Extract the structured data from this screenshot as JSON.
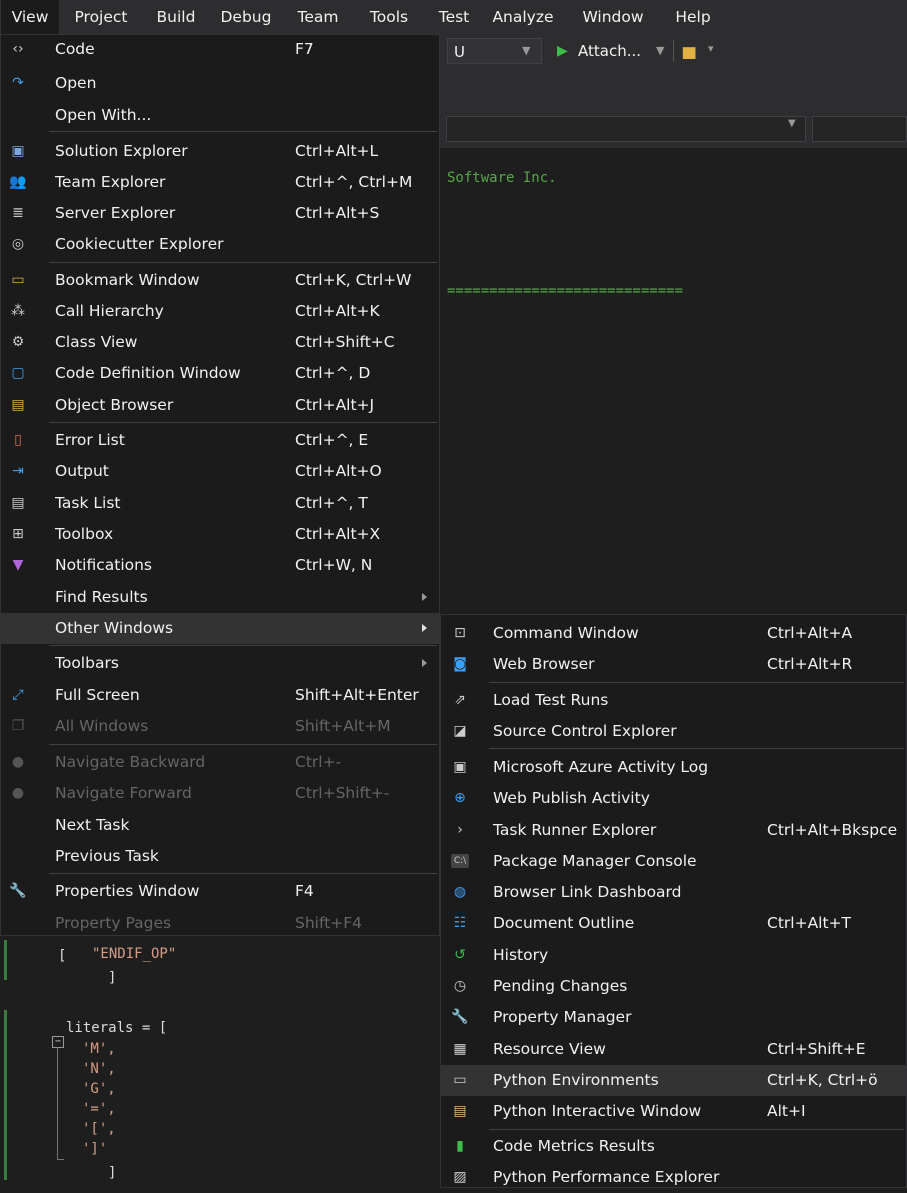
{
  "menubar": [
    "View",
    "Project",
    "Build",
    "Debug",
    "Team",
    "Tools",
    "Test",
    "Analyze",
    "Window",
    "Help"
  ],
  "toolbar": {
    "config_value": "U",
    "attach_label": "Attach..."
  },
  "editor": {
    "line_company": "Software Inc.",
    "line_rule": "============================",
    "code_lines": [
      {
        "text": "[",
        "cls": "plain"
      },
      {
        "text": "\"ENDIF_OP\"",
        "cls": "orange"
      },
      {
        "text": "]",
        "cls": "plain"
      },
      {
        "text": "literals = [",
        "cls": "plain"
      },
      {
        "text": "'M',",
        "cls": "orange"
      },
      {
        "text": "'N',",
        "cls": "orange"
      },
      {
        "text": "'G',",
        "cls": "orange"
      },
      {
        "text": "'=',",
        "cls": "orange"
      },
      {
        "text": "'[',",
        "cls": "orange"
      },
      {
        "text": "']'",
        "cls": "orange"
      },
      {
        "text": "]",
        "cls": "plain"
      }
    ]
  },
  "view_menu": [
    {
      "label": "Code",
      "shortcut": "F7",
      "icon": "code-icon",
      "glyph": "‹›",
      "color": "#cccccc"
    },
    {
      "label": "Open",
      "shortcut": "",
      "icon": "open-icon",
      "glyph": "↷",
      "color": "#3ea0f0"
    },
    {
      "label": "Open With...",
      "shortcut": "",
      "icon": "",
      "glyph": "",
      "color": ""
    },
    {
      "label": "Solution Explorer",
      "shortcut": "Ctrl+Alt+L",
      "icon": "solution-explorer-icon",
      "glyph": "▣",
      "color": "#7aa6d8"
    },
    {
      "label": "Team Explorer",
      "shortcut": "Ctrl+^, Ctrl+M",
      "icon": "team-explorer-icon",
      "glyph": "👥",
      "color": "#cccccc"
    },
    {
      "label": "Server Explorer",
      "shortcut": "Ctrl+Alt+S",
      "icon": "server-explorer-icon",
      "glyph": "≣",
      "color": "#cccccc"
    },
    {
      "label": "Cookiecutter Explorer",
      "shortcut": "",
      "icon": "cookiecutter-icon",
      "glyph": "◎",
      "color": "#cccccc"
    },
    {
      "label": "Bookmark Window",
      "shortcut": "Ctrl+K, Ctrl+W",
      "icon": "bookmark-icon",
      "glyph": "▭",
      "color": "#e0b040"
    },
    {
      "label": "Call Hierarchy",
      "shortcut": "Ctrl+Alt+K",
      "icon": "call-hierarchy-icon",
      "glyph": "⁂",
      "color": "#cccccc"
    },
    {
      "label": "Class View",
      "shortcut": "Ctrl+Shift+C",
      "icon": "class-view-icon",
      "glyph": "⚙",
      "color": "#cccccc"
    },
    {
      "label": "Code Definition Window",
      "shortcut": "Ctrl+^, D",
      "icon": "code-definition-icon",
      "glyph": "▢",
      "color": "#3ea0f0"
    },
    {
      "label": "Object Browser",
      "shortcut": "Ctrl+Alt+J",
      "icon": "object-browser-icon",
      "glyph": "▤",
      "color": "#e0b040"
    },
    {
      "label": "Error List",
      "shortcut": "Ctrl+^, E",
      "icon": "error-list-icon",
      "glyph": "▯",
      "color": "#e06c4a"
    },
    {
      "label": "Output",
      "shortcut": "Ctrl+Alt+O",
      "icon": "output-icon",
      "glyph": "⇥",
      "color": "#3ea0f0"
    },
    {
      "label": "Task List",
      "shortcut": "Ctrl+^, T",
      "icon": "task-list-icon",
      "glyph": "▤",
      "color": "#cccccc"
    },
    {
      "label": "Toolbox",
      "shortcut": "Ctrl+Alt+X",
      "icon": "toolbox-icon",
      "glyph": "⊞",
      "color": "#cccccc"
    },
    {
      "label": "Notifications",
      "shortcut": "Ctrl+W, N",
      "icon": "notifications-icon",
      "glyph": "▼",
      "color": "#b066d8"
    },
    {
      "label": "Find Results",
      "shortcut": "",
      "icon": "",
      "glyph": "",
      "color": "",
      "submenu": true
    },
    {
      "label": "Other Windows",
      "shortcut": "",
      "icon": "",
      "glyph": "",
      "color": "",
      "submenu": true,
      "highlighted": true
    },
    {
      "label": "Toolbars",
      "shortcut": "",
      "icon": "",
      "glyph": "",
      "color": "",
      "submenu": true
    },
    {
      "label": "Full Screen",
      "shortcut": "Shift+Alt+Enter",
      "icon": "full-screen-icon",
      "glyph": "⤢",
      "color": "#3ea0f0"
    },
    {
      "label": "All Windows",
      "shortcut": "Shift+Alt+M",
      "icon": "all-windows-icon",
      "glyph": "❐",
      "color": "#555555",
      "disabled": true
    },
    {
      "label": "Navigate Backward",
      "shortcut": "Ctrl+-",
      "icon": "navigate-backward-icon",
      "glyph": "●",
      "color": "#555555",
      "disabled": true
    },
    {
      "label": "Navigate Forward",
      "shortcut": "Ctrl+Shift+-",
      "icon": "navigate-forward-icon",
      "glyph": "●",
      "color": "#555555",
      "disabled": true
    },
    {
      "label": "Next Task",
      "shortcut": "",
      "icon": "",
      "glyph": "",
      "color": ""
    },
    {
      "label": "Previous Task",
      "shortcut": "",
      "icon": "",
      "glyph": "",
      "color": ""
    },
    {
      "label": "Properties Window",
      "shortcut": "F4",
      "icon": "properties-wrench-icon",
      "glyph": "🔧",
      "color": "#cccccc"
    },
    {
      "label": "Property Pages",
      "shortcut": "Shift+F4",
      "icon": "",
      "glyph": "",
      "color": "",
      "disabled": true
    }
  ],
  "other_windows_menu": [
    {
      "label": "Command Window",
      "shortcut": "Ctrl+Alt+A",
      "icon": "command-window-icon",
      "glyph": "⊡",
      "color": "#cccccc"
    },
    {
      "label": "Web Browser",
      "shortcut": "Ctrl+Alt+R",
      "icon": "web-browser-icon",
      "glyph": "◙",
      "color": "#3ea0f0"
    },
    {
      "label": "Load Test Runs",
      "shortcut": "",
      "icon": "load-test-icon",
      "glyph": "⇗",
      "color": "#cccccc"
    },
    {
      "label": "Source Control Explorer",
      "shortcut": "",
      "icon": "source-control-icon",
      "glyph": "◪",
      "color": "#cccccc"
    },
    {
      "label": "Microsoft Azure Activity Log",
      "shortcut": "",
      "icon": "azure-log-icon",
      "glyph": "▣",
      "color": "#cccccc"
    },
    {
      "label": "Web Publish Activity",
      "shortcut": "",
      "icon": "web-publish-icon",
      "glyph": "⊕",
      "color": "#3ea0f0"
    },
    {
      "label": "Task Runner Explorer",
      "shortcut": "Ctrl+Alt+Bkspce",
      "icon": "task-runner-icon",
      "glyph": "›",
      "color": "#cccccc"
    },
    {
      "label": "Package Manager Console",
      "shortcut": "",
      "icon": "package-manager-icon",
      "glyph": "C:\\",
      "color": "#cccccc"
    },
    {
      "label": "Browser Link Dashboard",
      "shortcut": "",
      "icon": "browser-link-icon",
      "glyph": "◍",
      "color": "#3ea0f0"
    },
    {
      "label": "Document Outline",
      "shortcut": "Ctrl+Alt+T",
      "icon": "document-outline-icon",
      "glyph": "☷",
      "color": "#3ea0f0"
    },
    {
      "label": "History",
      "shortcut": "",
      "icon": "history-icon",
      "glyph": "↺",
      "color": "#3fbd4a"
    },
    {
      "label": "Pending Changes",
      "shortcut": "",
      "icon": "pending-changes-icon",
      "glyph": "◷",
      "color": "#cccccc"
    },
    {
      "label": "Property Manager",
      "shortcut": "",
      "icon": "property-manager-icon",
      "glyph": "🔧",
      "color": "#cccccc"
    },
    {
      "label": "Resource View",
      "shortcut": "Ctrl+Shift+E",
      "icon": "resource-view-icon",
      "glyph": "▦",
      "color": "#cccccc"
    },
    {
      "label": "Python Environments",
      "shortcut": "Ctrl+K, Ctrl+ö",
      "icon": "python-environments-icon",
      "glyph": "▭",
      "color": "#cccccc",
      "highlighted": true
    },
    {
      "label": "Python Interactive Window",
      "shortcut": "Alt+I",
      "icon": "python-interactive-icon",
      "glyph": "▤",
      "color": "#e0c070"
    },
    {
      "label": "Code Metrics Results",
      "shortcut": "",
      "icon": "code-metrics-icon",
      "glyph": "▮",
      "color": "#3fbd4a"
    },
    {
      "label": "Python Performance Explorer",
      "shortcut": "",
      "icon": "python-performance-icon",
      "glyph": "▨",
      "color": "#cccccc"
    }
  ]
}
